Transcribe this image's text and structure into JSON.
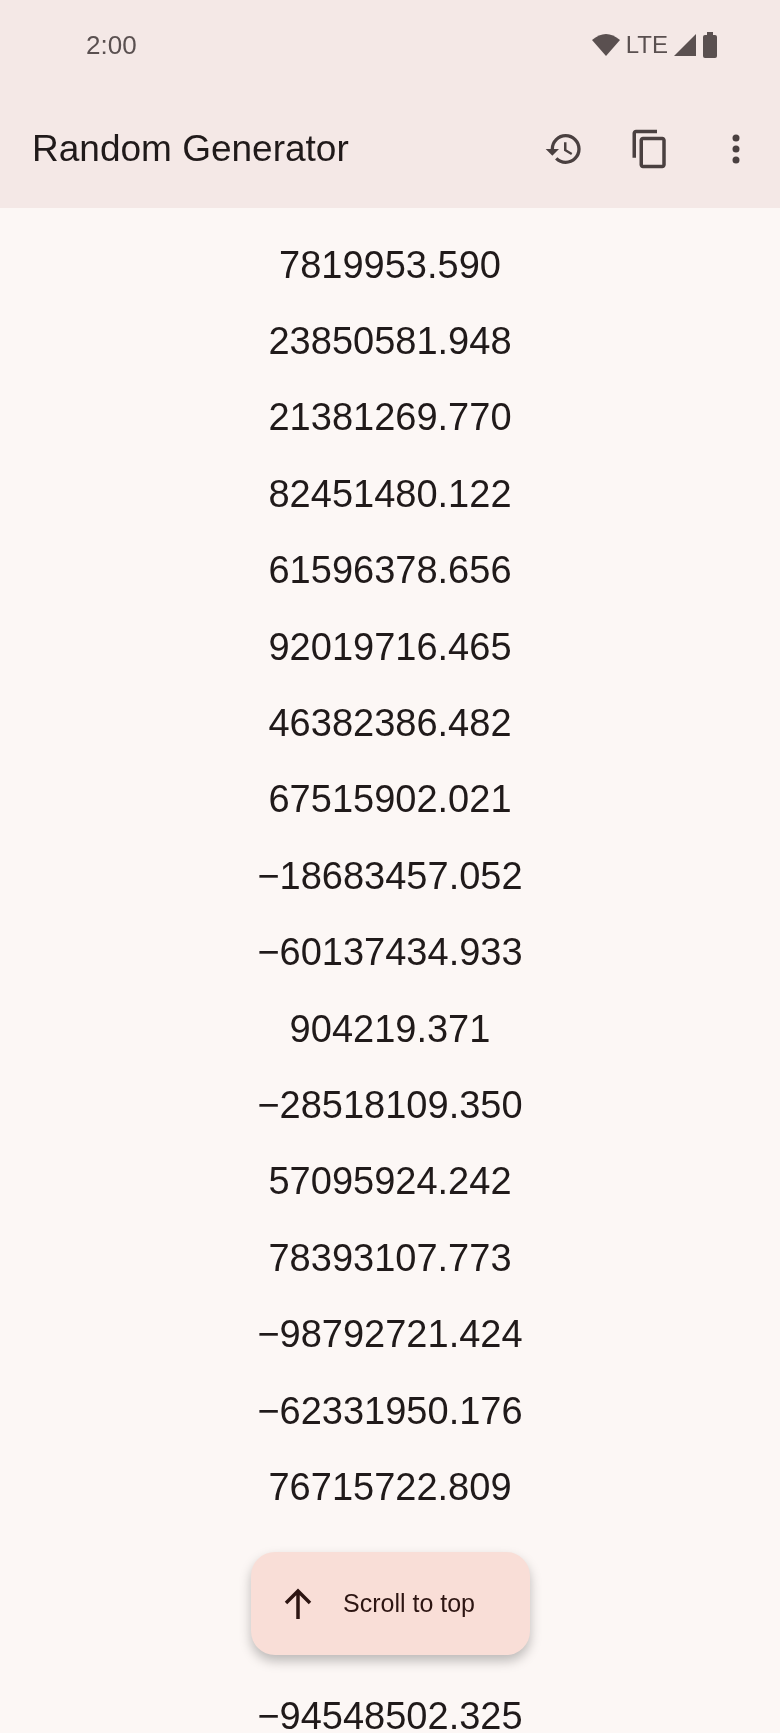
{
  "status_bar": {
    "time": "2:00",
    "network": "LTE"
  },
  "app_bar": {
    "title": "Random Generator"
  },
  "numbers": [
    {
      "value": "7819953.590"
    },
    {
      "value": "23850581.948"
    },
    {
      "value": "21381269.770"
    },
    {
      "value": "82451480.122"
    },
    {
      "value": "61596378.656"
    },
    {
      "value": "92019716.465"
    },
    {
      "value": "46382386.482"
    },
    {
      "value": "67515902.021"
    },
    {
      "value": "−18683457.052"
    },
    {
      "value": "−60137434.933"
    },
    {
      "value": "904219.371"
    },
    {
      "value": "−28518109.350"
    },
    {
      "value": "57095924.242"
    },
    {
      "value": "78393107.773"
    },
    {
      "value": "−98792721.424"
    },
    {
      "value": "−62331950.176"
    },
    {
      "value": "76715722.809"
    },
    {
      "value": "−94548502.325",
      "below_button": true
    }
  ],
  "fab": {
    "label": "Scroll to top"
  }
}
